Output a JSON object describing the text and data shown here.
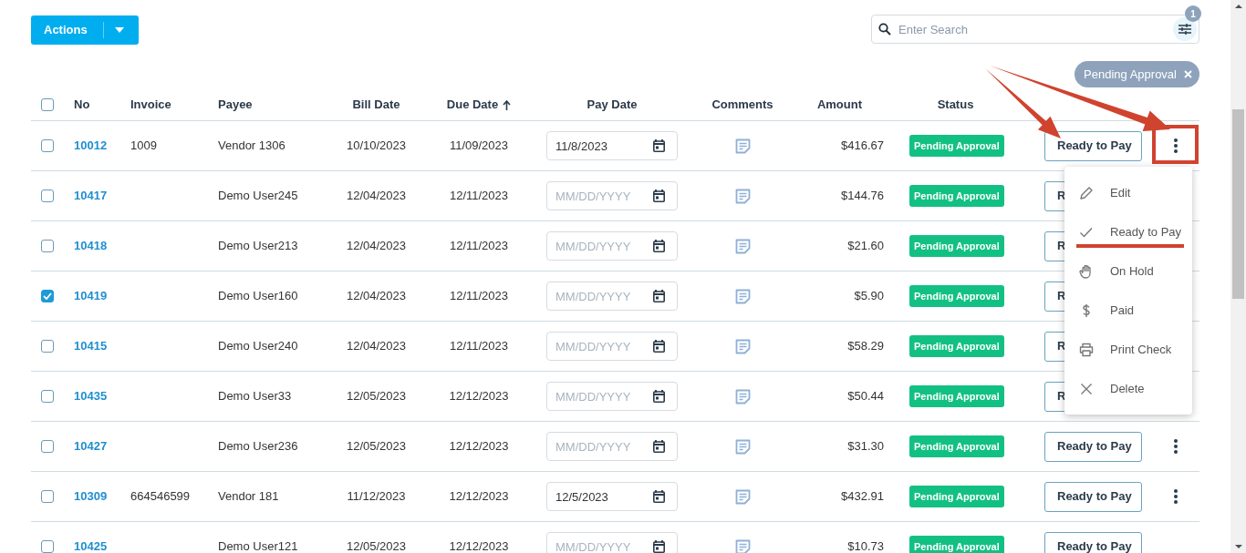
{
  "actions_button": {
    "label": "Actions"
  },
  "search": {
    "placeholder": "Enter Search",
    "filter_count": "1"
  },
  "filter_chips": [
    {
      "label": "Pending Approval"
    }
  ],
  "table": {
    "select_all_checked": false,
    "columns": [
      {
        "label": "No",
        "sorted": false
      },
      {
        "label": "Invoice",
        "sorted": false
      },
      {
        "label": "Payee",
        "sorted": false
      },
      {
        "label": "Bill Date",
        "sorted": false
      },
      {
        "label": "Due Date",
        "sorted": true
      },
      {
        "label": "Pay Date",
        "sorted": false
      },
      {
        "label": "Comments",
        "sorted": false
      },
      {
        "label": "Amount",
        "sorted": false
      },
      {
        "label": "Status",
        "sorted": false
      }
    ],
    "rows": [
      {
        "checked": false,
        "no": "10012",
        "invoice": "1009",
        "payee": "Vendor 1306",
        "bill_date": "10/10/2023",
        "due_date": "11/09/2023",
        "pay_date": "11/8/2023",
        "amount": "$416.67",
        "status": "Pending Approval",
        "action": "Ready to Pay"
      },
      {
        "checked": false,
        "no": "10417",
        "payee": "Demo User245",
        "bill_date": "12/04/2023",
        "due_date": "12/11/2023",
        "pay_date_placeholder": "MM/DD/YYYY",
        "amount": "$144.76",
        "status": "Pending Approval",
        "action": "R"
      },
      {
        "checked": false,
        "no": "10418",
        "payee": "Demo User213",
        "bill_date": "12/04/2023",
        "due_date": "12/11/2023",
        "pay_date_placeholder": "MM/DD/YYYY",
        "amount": "$21.60",
        "status": "Pending Approval",
        "action": "R"
      },
      {
        "checked": true,
        "no": "10419",
        "payee": "Demo User160",
        "bill_date": "12/04/2023",
        "due_date": "12/11/2023",
        "pay_date_placeholder": "MM/DD/YYYY",
        "amount": "$5.90",
        "status": "Pending Approval",
        "action": "R"
      },
      {
        "checked": false,
        "no": "10415",
        "payee": "Demo User240",
        "bill_date": "12/04/2023",
        "due_date": "12/11/2023",
        "pay_date_placeholder": "MM/DD/YYYY",
        "amount": "$58.29",
        "status": "Pending Approval",
        "action": "R"
      },
      {
        "checked": false,
        "no": "10435",
        "payee": "Demo User33",
        "bill_date": "12/05/2023",
        "due_date": "12/12/2023",
        "pay_date_placeholder": "MM/DD/YYYY",
        "amount": "$50.44",
        "status": "Pending Approval",
        "action": "R"
      },
      {
        "checked": false,
        "no": "10427",
        "payee": "Demo User236",
        "bill_date": "12/05/2023",
        "due_date": "12/12/2023",
        "pay_date_placeholder": "MM/DD/YYYY",
        "amount": "$31.30",
        "status": "Pending Approval",
        "action": "Ready to Pay"
      },
      {
        "checked": false,
        "no": "10309",
        "invoice": "664546599",
        "payee": "Vendor 181",
        "bill_date": "11/12/2023",
        "due_date": "12/12/2023",
        "pay_date": "12/5/2023",
        "amount": "$432.91",
        "status": "Pending Approval",
        "action": "Ready to Pay"
      },
      {
        "checked": false,
        "no": "10425",
        "payee": "Demo User121",
        "bill_date": "12/05/2023",
        "due_date": "12/12/2023",
        "pay_date_placeholder": "MM/DD/YYYY",
        "amount": "$10.73",
        "status": "Pending Approval",
        "action": "Ready to Pay"
      }
    ]
  },
  "row_menu": {
    "items": [
      {
        "kind": "edit",
        "label": "Edit"
      },
      {
        "kind": "check",
        "label": "Ready to Pay"
      },
      {
        "kind": "hold",
        "label": "On Hold"
      },
      {
        "kind": "paid",
        "label": "Paid"
      },
      {
        "kind": "print",
        "label": "Print Check"
      },
      {
        "kind": "delete",
        "label": "Delete"
      }
    ]
  },
  "annotations": [
    {
      "kind": "arrow"
    },
    {
      "kind": "arrow"
    },
    {
      "kind": "box"
    },
    {
      "kind": "underline"
    }
  ]
}
